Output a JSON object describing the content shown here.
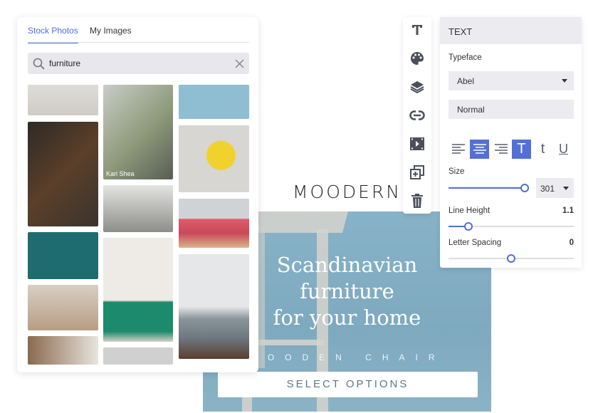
{
  "left_panel": {
    "tabs": [
      {
        "label": "Stock Photos",
        "active": true
      },
      {
        "label": "My Images",
        "active": false
      }
    ],
    "search": {
      "value": "furniture",
      "icon": "search-icon",
      "clear_icon": "close-icon"
    },
    "photo_caption": "Kari Shea"
  },
  "toolbar": {
    "icons": [
      "text-icon",
      "palette-icon",
      "layers-icon",
      "link-icon",
      "video-icon",
      "duplicate-icon",
      "trash-icon"
    ]
  },
  "text_panel": {
    "title": "TEXT",
    "typeface_label": "Typeface",
    "typeface_value": "Abel",
    "weight_value": "Normal",
    "format_buttons": [
      {
        "name": "align-left",
        "active": false
      },
      {
        "name": "align-center",
        "active": true
      },
      {
        "name": "align-right",
        "active": false
      },
      {
        "name": "uppercase",
        "active": true,
        "glyph": "T"
      },
      {
        "name": "lowercase",
        "active": false,
        "glyph": "t"
      },
      {
        "name": "underline",
        "active": false,
        "glyph": "U"
      }
    ],
    "size_label": "Size",
    "size_value": "301",
    "size_slider": 1.0,
    "line_height_label": "Line Height",
    "line_height_value": "1.1",
    "line_height_slider": 0.15,
    "letter_spacing_label": "Letter Spacing",
    "letter_spacing_value": "0",
    "letter_spacing_slider": 0.5,
    "accent": "#4f6ed9"
  },
  "canvas": {
    "logo": "MOODERN",
    "headline": [
      "Scandinavian",
      "furniture",
      "for your home"
    ],
    "subheading": "WOODEN CHAIR",
    "cta": "SELECT OPTIONS"
  }
}
